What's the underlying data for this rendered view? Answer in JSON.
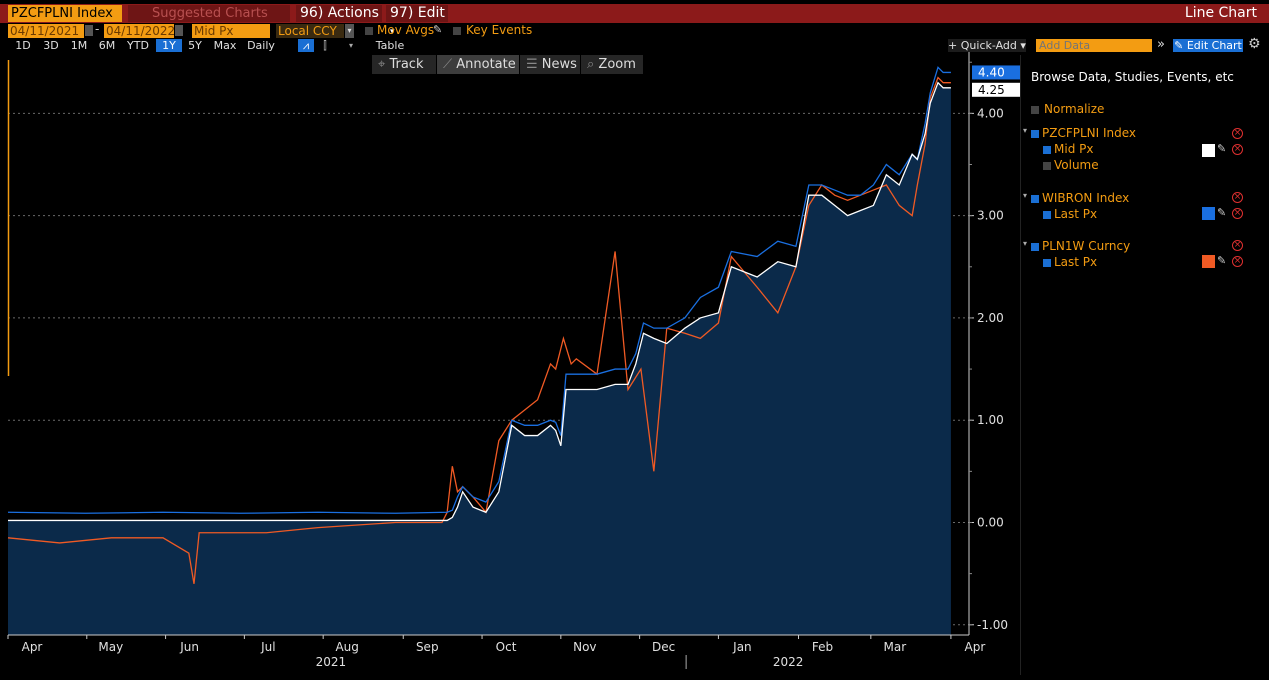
{
  "header": {
    "ticker": "PZCFPLNI Index",
    "suggested_charts": "Suggested Charts",
    "actions_label": "96) Actions",
    "edit_label": "97) Edit",
    "chart_type": "Line Chart"
  },
  "controls": {
    "start_date": "04/11/2021",
    "end_date": "04/11/2022",
    "price_field": "Mid Px",
    "currency": "Local CCY",
    "mov_avgs": "Mov Avgs",
    "key_events": "Key Events",
    "periods": [
      "1D",
      "3D",
      "1M",
      "6M",
      "YTD",
      "1Y",
      "5Y",
      "Max"
    ],
    "active_period": "1Y",
    "frequency": "Daily",
    "table_label": "Table",
    "quick_add": "Quick-Add",
    "add_data_placeholder": "Add Data",
    "edit_chart": "Edit Chart",
    "tools": [
      "Track",
      "Annotate",
      "News",
      "Zoom"
    ],
    "active_tool": "Annotate"
  },
  "panel": {
    "browse": "Browse Data, Studies, Events, etc",
    "normalize": "Normalize",
    "securities": [
      {
        "name": "PZCFPLNI Index",
        "fields": [
          {
            "label": "Mid Px",
            "checked": true,
            "color": "#ffffff"
          },
          {
            "label": "Volume",
            "checked": false
          }
        ]
      },
      {
        "name": "WIBRON Index",
        "fields": [
          {
            "label": "Last Px",
            "checked": true,
            "color": "#1a6fe0"
          }
        ]
      },
      {
        "name": "PLN1W Curncy",
        "fields": [
          {
            "label": "Last Px",
            "checked": true,
            "color": "#f05a24"
          }
        ]
      }
    ]
  },
  "chart_data": {
    "type": "line",
    "ylim": [
      -1.1,
      4.6
    ],
    "y_ticks": [
      "-1.00",
      "0.00",
      "1.00",
      "2.00",
      "3.00",
      "4.00"
    ],
    "x_month_labels": [
      "Apr",
      "May",
      "Jun",
      "Jul",
      "Aug",
      "Sep",
      "Oct",
      "Nov",
      "Dec",
      "Jan",
      "Feb",
      "Mar",
      "Apr"
    ],
    "year_labels": [
      "2021",
      "2022"
    ],
    "last_values": {
      "blue": "4.40",
      "white": "4.25"
    },
    "series": [
      {
        "name": "PZCFPLNI Index Mid Px",
        "color": "#ffffff",
        "area": true,
        "x": [
          0,
          30,
          60,
          90,
          120,
          150,
          170,
          172,
          174,
          176,
          180,
          185,
          190,
          195,
          200,
          205,
          210,
          212,
          214,
          216,
          220,
          228,
          235,
          240,
          243,
          246,
          250,
          255,
          262,
          268,
          275,
          280,
          290,
          298,
          305,
          310,
          315,
          320,
          325,
          330,
          335,
          340,
          345,
          350,
          352,
          355,
          357,
          360,
          362,
          365
        ],
        "y": [
          0.02,
          0.02,
          0.02,
          0.02,
          0.02,
          0.02,
          0.02,
          0.05,
          0.15,
          0.3,
          0.15,
          0.1,
          0.3,
          0.95,
          0.85,
          0.85,
          0.95,
          0.9,
          0.75,
          1.3,
          1.3,
          1.3,
          1.35,
          1.35,
          1.55,
          1.85,
          1.8,
          1.75,
          1.9,
          2.0,
          2.05,
          2.5,
          2.4,
          2.55,
          2.5,
          3.2,
          3.2,
          3.1,
          3.0,
          3.05,
          3.1,
          3.4,
          3.3,
          3.6,
          3.55,
          3.8,
          4.1,
          4.3,
          4.25,
          4.25
        ]
      },
      {
        "name": "WIBRON Index Last Px",
        "color": "#1a6fe0",
        "x": [
          0,
          30,
          60,
          90,
          120,
          150,
          170,
          172,
          174,
          176,
          180,
          185,
          190,
          195,
          200,
          205,
          210,
          212,
          214,
          216,
          220,
          228,
          235,
          240,
          243,
          246,
          250,
          255,
          262,
          268,
          275,
          280,
          290,
          298,
          305,
          310,
          315,
          320,
          325,
          330,
          335,
          340,
          345,
          350,
          352,
          355,
          357,
          360,
          362,
          365
        ],
        "y": [
          0.1,
          0.09,
          0.1,
          0.09,
          0.1,
          0.09,
          0.1,
          0.12,
          0.25,
          0.35,
          0.25,
          0.2,
          0.4,
          1.0,
          0.95,
          0.95,
          1.0,
          0.98,
          0.85,
          1.45,
          1.45,
          1.45,
          1.5,
          1.5,
          1.65,
          1.95,
          1.9,
          1.9,
          2.0,
          2.2,
          2.3,
          2.65,
          2.6,
          2.75,
          2.7,
          3.3,
          3.3,
          3.25,
          3.2,
          3.2,
          3.3,
          3.5,
          3.4,
          3.6,
          3.55,
          3.9,
          4.2,
          4.45,
          4.4,
          4.4
        ]
      },
      {
        "name": "PLN1W Curncy Last Px",
        "color": "#f05a24",
        "x": [
          0,
          20,
          40,
          60,
          70,
          72,
          74,
          76,
          80,
          100,
          120,
          150,
          168,
          170,
          172,
          174,
          176,
          180,
          185,
          190,
          195,
          200,
          205,
          210,
          212,
          215,
          218,
          220,
          228,
          235,
          240,
          245,
          250,
          255,
          262,
          268,
          275,
          280,
          290,
          298,
          305,
          310,
          315,
          320,
          325,
          330,
          335,
          340,
          345,
          350,
          352,
          355,
          357,
          360,
          362,
          365
        ],
        "y": [
          -0.15,
          -0.2,
          -0.15,
          -0.15,
          -0.3,
          -0.6,
          -0.1,
          -0.1,
          -0.1,
          -0.1,
          -0.05,
          0.0,
          0.0,
          0.1,
          0.55,
          0.3,
          0.35,
          0.25,
          0.1,
          0.8,
          1.0,
          1.1,
          1.2,
          1.55,
          1.5,
          1.8,
          1.55,
          1.6,
          1.45,
          2.65,
          1.3,
          1.5,
          0.5,
          1.9,
          1.85,
          1.8,
          1.95,
          2.6,
          2.3,
          2.05,
          2.5,
          3.1,
          3.3,
          3.2,
          3.15,
          3.2,
          3.25,
          3.3,
          3.1,
          3.0,
          3.3,
          3.7,
          4.15,
          4.35,
          4.3,
          4.3
        ]
      }
    ]
  }
}
